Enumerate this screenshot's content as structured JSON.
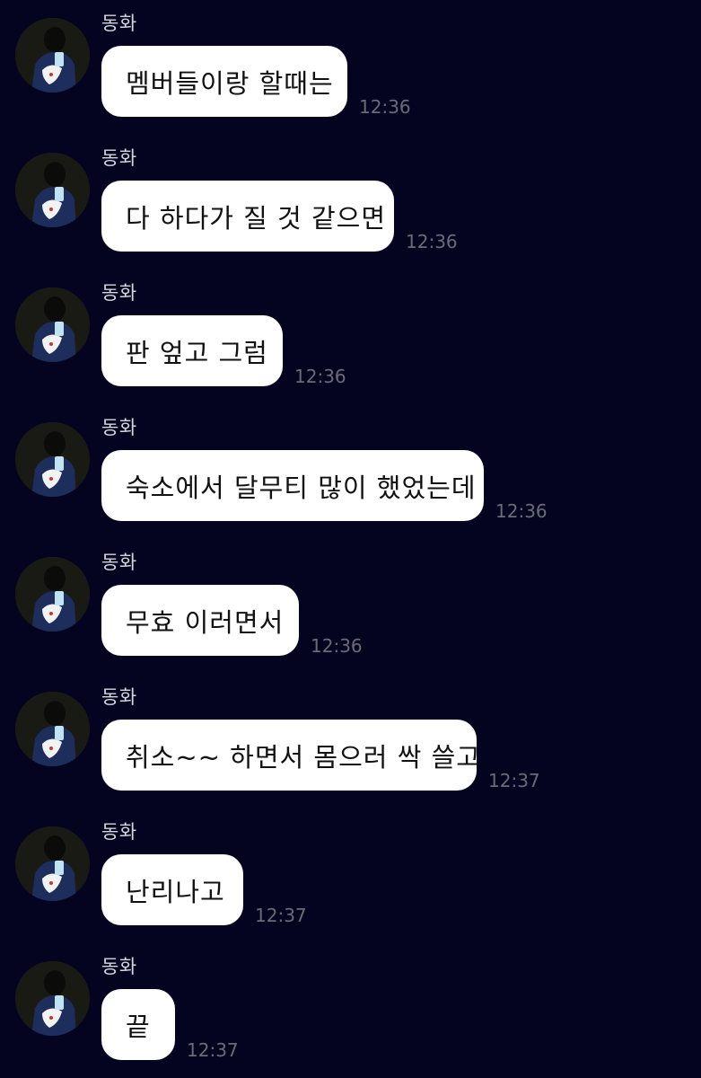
{
  "messages": [
    {
      "sender": "동화",
      "text": "멤버들이랑 할때는",
      "time": "12:36"
    },
    {
      "sender": "동화",
      "text": "다 하다가 질 것 같으면",
      "time": "12:36"
    },
    {
      "sender": "동화",
      "text": "판 엎고 그럼",
      "time": "12:36"
    },
    {
      "sender": "동화",
      "text": "숙소에서 달무티 많이 했었는데",
      "time": "12:36"
    },
    {
      "sender": "동화",
      "text": "무효 이러면서",
      "time": "12:36"
    },
    {
      "sender": "동화",
      "text": "취소~~ 하면서 몸으러 싹 쓸고",
      "time": "12:37"
    },
    {
      "sender": "동화",
      "text": "난리나고",
      "time": "12:37"
    },
    {
      "sender": "동화",
      "text": "끝",
      "time": "12:37"
    }
  ],
  "colors": {
    "background": "#050420",
    "bubble": "#ffffff",
    "bubble_text": "#111111",
    "sender_text": "#d6d6de",
    "time_text": "#6b6b78"
  }
}
